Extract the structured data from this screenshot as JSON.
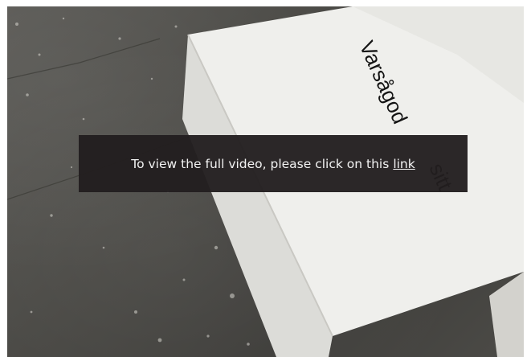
{
  "video": {
    "box_label_line1": "Varsågod",
    "box_label_line2": "sitt"
  },
  "overlay": {
    "message": "To view the full video, please click on this",
    "link_label": "link"
  }
}
